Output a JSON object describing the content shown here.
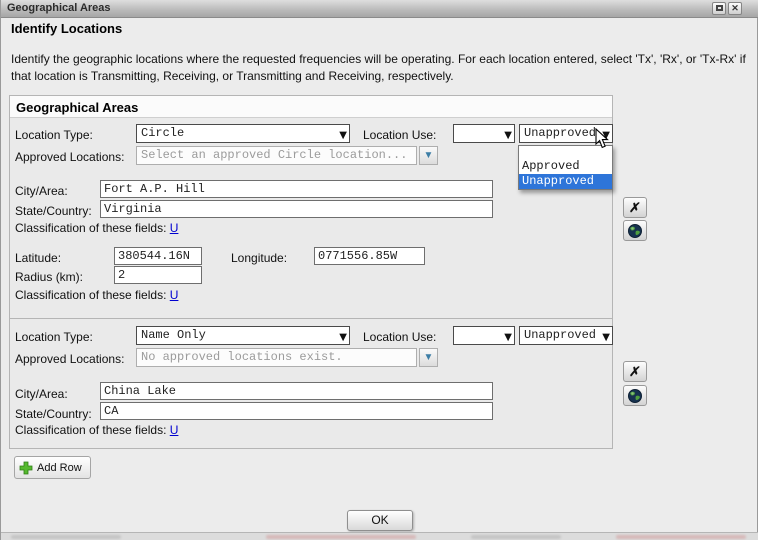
{
  "window": {
    "title": "Geographical Areas"
  },
  "icons": {
    "close": "✕",
    "delete_x": "✗",
    "chevron_down": "▼",
    "combo_chevron": "▼"
  },
  "intro": {
    "heading": "Identify Locations",
    "body": "Identify the geographic locations where the requested frequencies will be operating. For each location entered, select 'Tx', 'Rx', or 'Tx-Rx' if that location is Transmitting, Receiving, or Transmitting and Receiving, respectively."
  },
  "panel": {
    "title": "Geographical Areas"
  },
  "labels": {
    "location_type": "Location Type:",
    "location_use": "Location Use:",
    "approved_locations": "Approved Locations:",
    "city": "City/Area:",
    "state": "State/Country:",
    "classification": "Classification of these fields: ",
    "classification_link": "U",
    "latitude": "Latitude:",
    "longitude": "Longitude:",
    "radius": "Radius (km):"
  },
  "rows": [
    {
      "location_type": "Circle",
      "location_use": "",
      "status": "Unapproved",
      "approved_locations_placeholder": "Select an approved Circle location...",
      "city": "Fort A.P. Hill",
      "state": "Virginia",
      "latitude": "380544.16N",
      "longitude": "0771556.85W",
      "radius": "2"
    },
    {
      "location_type": "Name Only",
      "location_use": "",
      "status": "Unapproved",
      "approved_locations_placeholder": "No approved locations exist.",
      "city": "China Lake",
      "state": "CA"
    }
  ],
  "status_dropdown": {
    "options": [
      "",
      "Approved",
      "Unapproved"
    ],
    "selected": "Unapproved",
    "highlight_color": "#2e75d9"
  },
  "buttons": {
    "add_row": "Add Row",
    "ok": "OK"
  }
}
